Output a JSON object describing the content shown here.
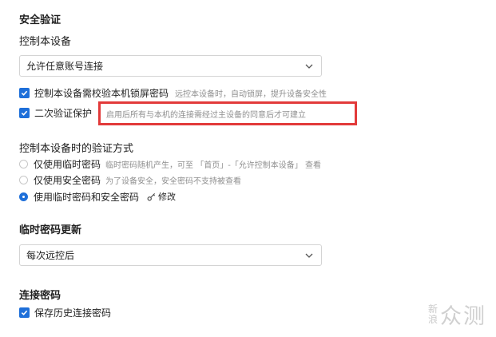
{
  "security": {
    "title": "安全验证",
    "control_device_title": "控制本设备",
    "control_select_value": "允许任意账号连接",
    "lock_screen_check": {
      "label": "控制本设备需校验本机锁屏密码",
      "hint": "远控本设备时，自动锁屏，提升设备安全性"
    },
    "two_factor_check": {
      "label": "二次验证保护",
      "hint": "启用后所有与本机的连接需经过主设备的同意后才可建立"
    }
  },
  "verify": {
    "title": "控制本设备时的验证方式",
    "options": [
      {
        "label": "仅使用临时密码",
        "hint": "临时密码随机产生，可至 「首页」-「允许控制本设备」 查看",
        "checked": false
      },
      {
        "label": "仅使用安全密码",
        "hint": "为了设备安全，安全密码不支持被查看",
        "checked": false
      },
      {
        "label": "使用临时密码和安全密码",
        "hint": "",
        "checked": true
      }
    ],
    "edit_label": "修改"
  },
  "temp_password": {
    "title": "临时密码更新",
    "select_value": "每次远控后"
  },
  "connection_password": {
    "title": "连接密码",
    "save_history_label": "保存历史连接密码"
  },
  "watermark": {
    "chars_top": "新",
    "chars_bottom": "浪",
    "brand": "众测"
  },
  "colors": {
    "accent": "#1e6fd9",
    "highlight_border": "#e23a3a",
    "hint_text": "#8f8f8f"
  }
}
